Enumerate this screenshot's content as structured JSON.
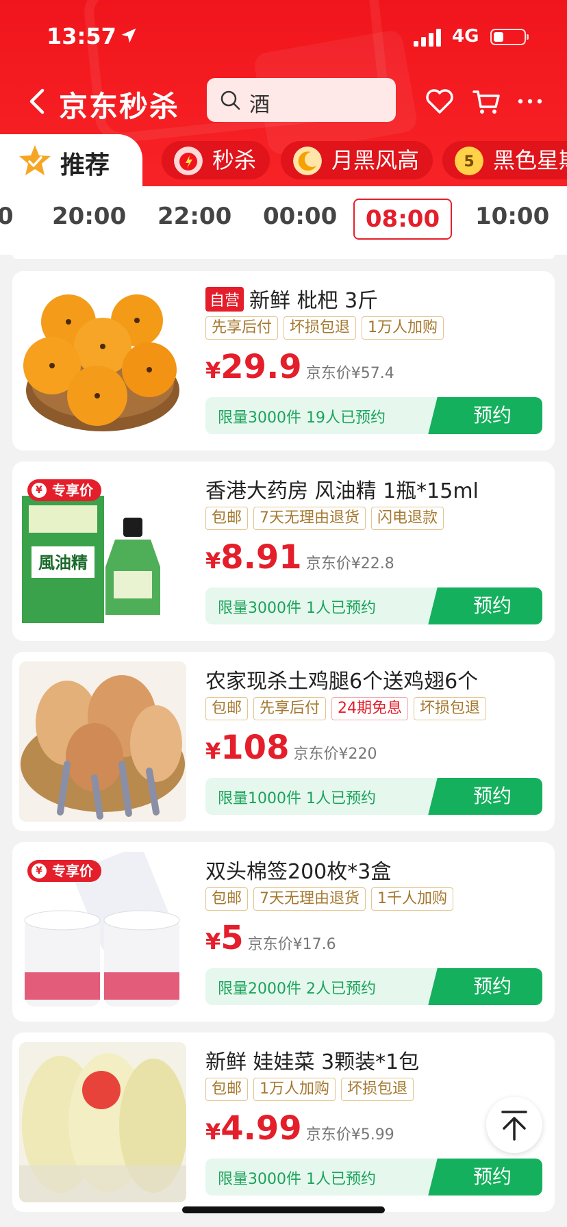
{
  "status_bar": {
    "time": "13:57",
    "network": "4G"
  },
  "nav": {
    "brand": "京东秒杀",
    "search_text": "酒"
  },
  "categories": {
    "active": "推荐",
    "items": [
      {
        "label": "秒杀"
      },
      {
        "label": "月黑风高"
      },
      {
        "label": "黑色星期"
      }
    ]
  },
  "time_slots": [
    "0",
    "20:00",
    "22:00",
    "00:00",
    "08:00",
    "10:00"
  ],
  "products": [
    {
      "self_operated": "自营",
      "title": "新鲜 枇杷 3斤",
      "tags": [
        "先享后付",
        "坏损包退",
        "1万人加购"
      ],
      "price": "29.9",
      "jd_price": "京东价¥57.4",
      "limit": "限量3000件  19人已预约",
      "button": "预约"
    },
    {
      "badge": "专享价",
      "title": "香港大药房 风油精 1瓶*15ml",
      "tags": [
        "包邮",
        "7天无理由退货",
        "闪电退款"
      ],
      "price": "8.91",
      "jd_price": "京东价¥22.8",
      "limit": "限量3000件  1人已预约",
      "button": "预约"
    },
    {
      "title": "农家现杀土鸡腿6个送鸡翅6个",
      "tags": [
        "包邮",
        "先享后付",
        "24期免息",
        "坏损包退"
      ],
      "price": "108",
      "jd_price": "京东价¥220",
      "limit": "限量1000件  1人已预约",
      "button": "预约"
    },
    {
      "badge": "专享价",
      "title": "双头棉签200枚*3盒",
      "tags": [
        "包邮",
        "7天无理由退货",
        "1千人加购"
      ],
      "price": "5",
      "jd_price": "京东价¥17.6",
      "limit": "限量2000件  2人已预约",
      "button": "预约"
    },
    {
      "title": "新鲜 娃娃菜 3颗装*1包",
      "tags": [
        "包邮",
        "1万人加购",
        "坏损包退"
      ],
      "price": "4.99",
      "jd_price": "京东价¥5.99",
      "limit": "限量3000件  1人已预约",
      "button": "预约"
    }
  ],
  "currency_symbol": "¥",
  "colors": {
    "brand_red": "#f0151c",
    "price_red": "#e41e2a",
    "reserve_green": "#15b05d"
  }
}
